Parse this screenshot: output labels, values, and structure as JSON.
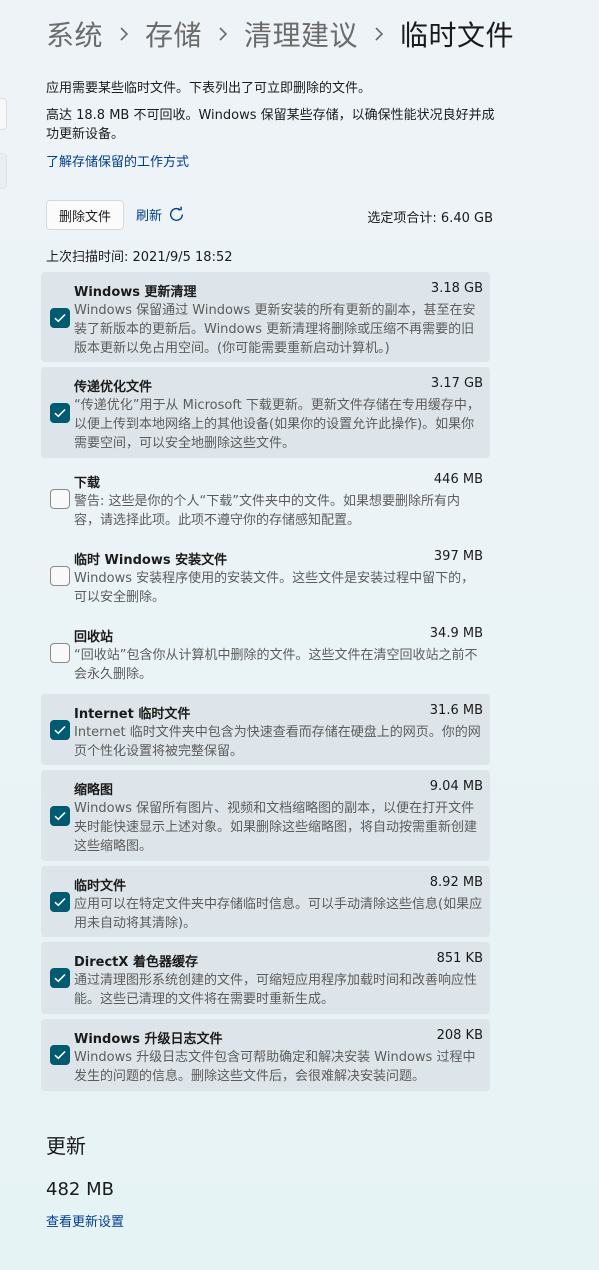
{
  "breadcrumb": [
    "系统",
    "存储",
    "清理建议",
    "临时文件"
  ],
  "description": {
    "line1": "应用需要某些临时文件。下表列出了可立即删除的文件。",
    "line2": "高达 18.8 MB 不可回收。Windows 保留某些存储，以确保性能状况良好并成功更新设备。"
  },
  "learn_link": "了解存储保留的工作方式",
  "toolbar": {
    "delete_label": "删除文件",
    "refresh_label": "刷新",
    "selected_total": "选定项合计: 6.40 GB"
  },
  "last_scan": "上次扫描时间: 2021/9/5 18:52",
  "items": [
    {
      "title": "Windows 更新清理",
      "size": "3.18 GB",
      "checked": true,
      "desc": "Windows 保留通过 Windows 更新安装的所有更新的副本，甚至在安装了新版本的更新后。Windows 更新清理将删除或压缩不再需要的旧版本更新以免占用空间。(你可能需要重新启动计算机。)"
    },
    {
      "title": "传递优化文件",
      "size": "3.17 GB",
      "checked": true,
      "desc": "“传递优化”用于从 Microsoft 下载更新。更新文件存储在专用缓存中，以便上传到本地网络上的其他设备(如果你的设置允许此操作)。如果你需要空间，可以安全地删除这些文件。"
    },
    {
      "title": "下载",
      "size": "446 MB",
      "checked": false,
      "desc": "警告: 这些是你的个人“下载”文件夹中的文件。如果想要删除所有内容，请选择此项。此项不遵守你的存储感知配置。"
    },
    {
      "title": "临时 Windows 安装文件",
      "size": "397 MB",
      "checked": false,
      "desc": "Windows 安装程序使用的安装文件。这些文件是安装过程中留下的，可以安全删除。"
    },
    {
      "title": "回收站",
      "size": "34.9 MB",
      "checked": false,
      "desc": "“回收站”包含你从计算机中删除的文件。这些文件在清空回收站之前不会永久删除。"
    },
    {
      "title": "Internet 临时文件",
      "size": "31.6 MB",
      "checked": true,
      "desc": "Internet 临时文件夹中包含为快速查看而存储在硬盘上的网页。你的网页个性化设置将被完整保留。"
    },
    {
      "title": "缩略图",
      "size": "9.04 MB",
      "checked": true,
      "desc": "Windows 保留所有图片、视频和文档缩略图的副本，以便在打开文件夹时能快速显示上述对象。如果删除这些缩略图，将自动按需重新创建这些缩略图。"
    },
    {
      "title": "临时文件",
      "size": "8.92 MB",
      "checked": true,
      "desc": "应用可以在特定文件夹中存储临时信息。可以手动清除这些信息(如果应用未自动将其清除)。"
    },
    {
      "title": "DirectX 着色器缓存",
      "size": "851 KB",
      "checked": true,
      "desc": "通过清理图形系统创建的文件，可缩短应用程序加载时间和改善响应性能。这些已清理的文件将在需要时重新生成。"
    },
    {
      "title": "Windows 升级日志文件",
      "size": "208 KB",
      "checked": true,
      "desc": "Windows 升级日志文件包含可帮助确定和解决安装 Windows 过程中发生的问题的信息。删除这些文件后，会很难解决安装问题。"
    }
  ],
  "updates": {
    "title": "更新",
    "size": "482 MB",
    "link": "查看更新设置"
  },
  "colors": {
    "accent": "#005b70",
    "link": "#003e92",
    "checked_bg": "#dde5ea"
  }
}
